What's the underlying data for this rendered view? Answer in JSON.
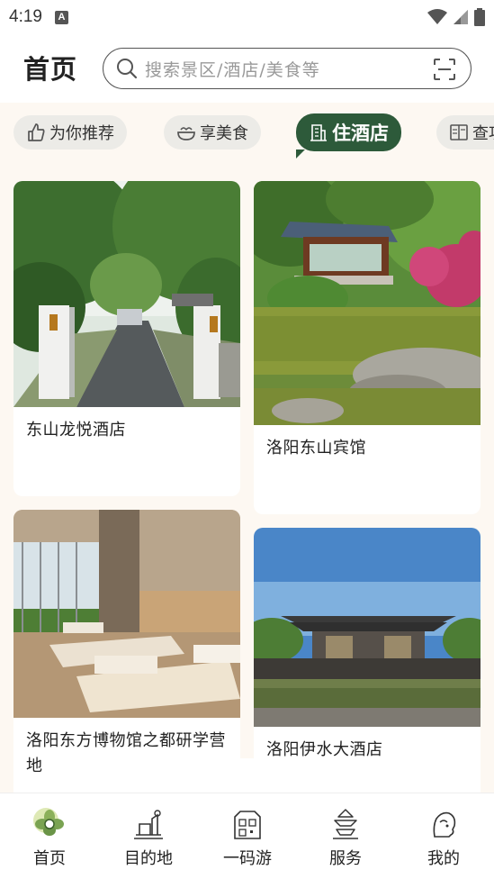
{
  "status_bar": {
    "time": "4:19",
    "notification_badge": "A"
  },
  "header": {
    "title": "首页",
    "search_placeholder": "搜索景区/酒店/美食等"
  },
  "categories": [
    {
      "label": "为你推荐",
      "icon": "thumb-up-icon",
      "active": false
    },
    {
      "label": "享美食",
      "icon": "bowl-icon",
      "active": false
    },
    {
      "label": "住酒店",
      "icon": "building-icon",
      "active": true
    },
    {
      "label": "查攻",
      "icon": "book-icon",
      "active": false
    }
  ],
  "hotels": [
    {
      "name": "东山龙悦酒店",
      "image": "gate-driveway-photo"
    },
    {
      "name": "洛阳东山宾馆",
      "image": "pavilion-pond-photo"
    },
    {
      "name": "洛阳东方博物馆之都研学营地",
      "image": "dormitory-room-photo"
    },
    {
      "name": "洛阳伊水大酒店",
      "image": "hotel-exterior-photo"
    }
  ],
  "bottom_nav": [
    {
      "label": "首页",
      "icon": "home-flower-icon",
      "active": true
    },
    {
      "label": "目的地",
      "icon": "destination-icon",
      "active": false
    },
    {
      "label": "一码游",
      "icon": "qr-tour-icon",
      "active": false
    },
    {
      "label": "服务",
      "icon": "service-pagoda-icon",
      "active": false
    },
    {
      "label": "我的",
      "icon": "profile-icon",
      "active": false
    }
  ],
  "colors": {
    "accent": "#2d5a3a",
    "background": "#fdf8f2",
    "chip": "#ecebe7"
  }
}
